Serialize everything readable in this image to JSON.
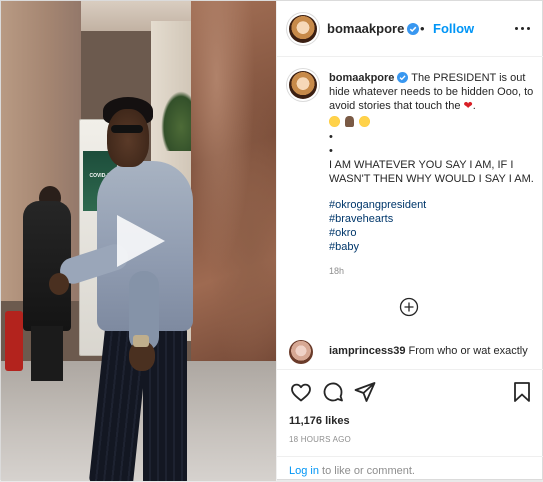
{
  "header": {
    "username": "bomaakpore",
    "separator": "•",
    "follow_label": "Follow"
  },
  "caption": {
    "username": "bomaakpore",
    "line1": "The PRESIDENT is out hide whatever needs to be hidden Ooo, to avoid stories that touch the",
    "heart": "❤",
    "dot1": "•",
    "dot2": "•",
    "body": "I AM WHATEVER YOU SAY I AM, IF I WASN'T THEN WHY WOULD I SAY I AM.",
    "hashtags": [
      "#okrogangpresident",
      "#bravehearts",
      "#okro",
      "#baby"
    ],
    "emojis": [
      "smirking-face",
      "folded-hands",
      "laughing-face"
    ],
    "time": "18h"
  },
  "comment": {
    "username": "iamprincess39",
    "text": "From who or wat exactly"
  },
  "stats": {
    "likes": "11,176 likes",
    "date": "18 HOURS AGO"
  },
  "login": {
    "link": "Log in",
    "rest": " to like or comment."
  },
  "video_signage": {
    "text": "COVID-19"
  },
  "colors": {
    "accent": "#0095f6",
    "verified": "#3897f0",
    "hashtag": "#00376b",
    "heart": "#d81f26",
    "muted": "#8e8e8e"
  },
  "icons": [
    "play-icon",
    "verified-badge-icon",
    "more-options-icon",
    "load-more-comments-icon",
    "heart-icon",
    "comment-icon",
    "share-icon",
    "bookmark-icon"
  ]
}
